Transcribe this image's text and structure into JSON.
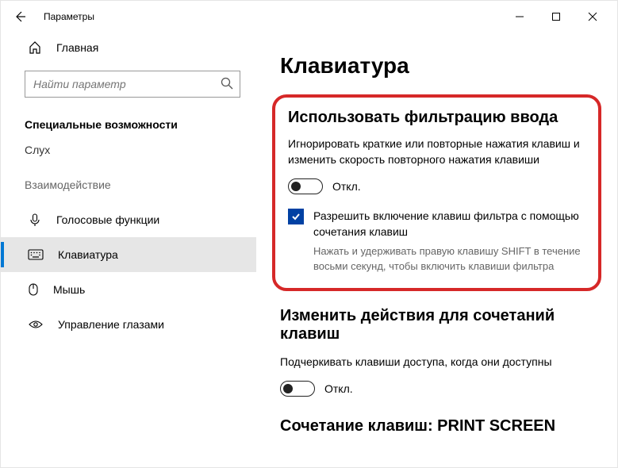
{
  "titlebar": {
    "title": "Параметры"
  },
  "sidebar": {
    "home": "Главная",
    "search_placeholder": "Найти параметр",
    "category": "Специальные возможности",
    "subcat": "Слух",
    "section": "Взаимодействие",
    "items": [
      {
        "label": "Голосовые функции"
      },
      {
        "label": "Клавиатура"
      },
      {
        "label": "Мышь"
      },
      {
        "label": "Управление глазами"
      }
    ]
  },
  "page": {
    "title": "Клавиатура",
    "filter": {
      "heading": "Использовать фильтрацию ввода",
      "desc": "Игнорировать краткие или повторные нажатия клавиш и изменить скорость повторного нажатия клавиши",
      "toggle_state": "Откл.",
      "checkbox_label": "Разрешить включение клавиш фильтра с помощью сочетания клавиш",
      "checkbox_hint": "Нажать и удерживать правую клавишу SHIFT в течение восьми секунд, чтобы включить клавиши фильтра"
    },
    "shortcut": {
      "heading": "Изменить действия для сочетаний клавиш",
      "desc": "Подчеркивать клавиши доступа, когда они доступны",
      "toggle_state": "Откл."
    },
    "printscreen": {
      "heading": "Сочетание клавиш: PRINT SCREEN"
    }
  }
}
